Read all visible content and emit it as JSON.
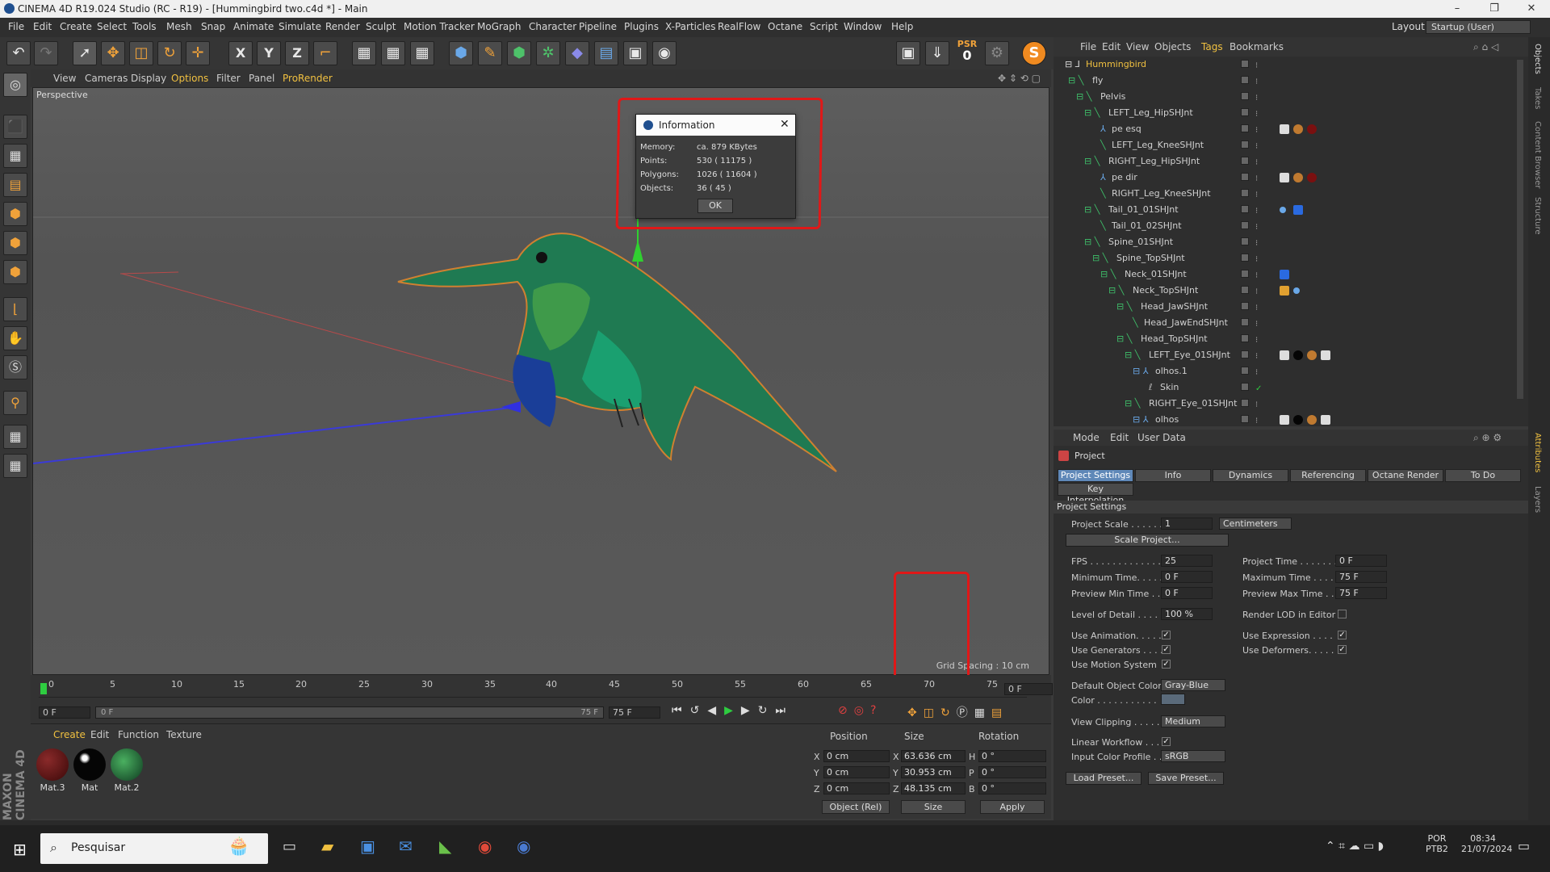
{
  "window": {
    "title": "CINEMA 4D R19.024 Studio (RC - R19) - [Hummingbird two.c4d *] - Main",
    "minimize": "–",
    "restore": "❐",
    "close": "✕"
  },
  "menubar": {
    "items": [
      "File",
      "Edit",
      "Create",
      "Select",
      "Tools",
      "Mesh",
      "Snap",
      "Animate",
      "Simulate",
      "Render",
      "Sculpt",
      "Motion Tracker",
      "MoGraph",
      "Character",
      "Pipeline",
      "Plugins",
      "X-Particles",
      "RealFlow",
      "Octane",
      "Script",
      "Window",
      "Help"
    ],
    "layout_label": "Layout:",
    "layout_value": "Startup (User)"
  },
  "toolbar": {
    "psr_label": "PSR",
    "psr_value": "0",
    "x_label": "X",
    "y_label": "Y",
    "z_label": "Z"
  },
  "viewport": {
    "menu": [
      "View",
      "Cameras",
      "Display",
      "Options",
      "Filter",
      "Panel",
      "ProRender"
    ],
    "label": "Perspective",
    "grid_spacing": "Grid Spacing : 10 cm"
  },
  "dialog": {
    "title": "Information",
    "rows": [
      {
        "label": "Memory:",
        "value": "ca. 879 KBytes"
      },
      {
        "label": "Points:",
        "value": "530 ( 11175 )"
      },
      {
        "label": "Polygons:",
        "value": "1026 ( 11604 )"
      },
      {
        "label": "Objects:",
        "value": "36 ( 45 )"
      }
    ],
    "ok_label": "OK"
  },
  "timeline": {
    "ticks": [
      "0",
      "5",
      "10",
      "15",
      "20",
      "25",
      "30",
      "35",
      "40",
      "45",
      "50",
      "55",
      "60",
      "65",
      "70",
      "75"
    ],
    "current_frame_right": "0 F",
    "start_field": "0 F",
    "slider_left": "0 F",
    "slider_right": "75 F",
    "end_field": "75 F"
  },
  "materials": {
    "tabs": [
      "Create",
      "Edit",
      "Function",
      "Texture"
    ],
    "items": [
      {
        "label": "Mat.3",
        "color": "#5a1212"
      },
      {
        "label": "Mat",
        "color": "#050505"
      },
      {
        "label": "Mat.2",
        "color": "#1f6b3a"
      }
    ],
    "brand": "MAXON CINEMA 4D"
  },
  "coords": {
    "headers": {
      "position": "Position",
      "size": "Size",
      "rotation": "Rotation"
    },
    "rows": [
      {
        "axis": "X",
        "pos": "0 cm",
        "size_axis": "X",
        "size": "63.636 cm",
        "rot_axis": "H",
        "rot": "0 °"
      },
      {
        "axis": "Y",
        "pos": "0 cm",
        "size_axis": "Y",
        "size": "30.953 cm",
        "rot_axis": "P",
        "rot": "0 °"
      },
      {
        "axis": "Z",
        "pos": "0 cm",
        "size_axis": "Z",
        "size": "48.135 cm",
        "rot_axis": "B",
        "rot": "0 °"
      }
    ],
    "mode": "Object (Rel)",
    "size_mode": "Size",
    "apply": "Apply"
  },
  "object_manager": {
    "menu": [
      "File",
      "Edit",
      "View",
      "Objects",
      "Tags",
      "Bookmarks"
    ],
    "rows": [
      {
        "name": "Hummingbird",
        "indent": 0
      },
      {
        "name": "fly",
        "indent": 1
      },
      {
        "name": "Pelvis",
        "indent": 2
      },
      {
        "name": "LEFT_Leg_HipSHJnt",
        "indent": 3
      },
      {
        "name": "pe esq",
        "indent": 4
      },
      {
        "name": "LEFT_Leg_KneeSHJnt",
        "indent": 4
      },
      {
        "name": "RIGHT_Leg_HipSHJnt",
        "indent": 3
      },
      {
        "name": "pe dir",
        "indent": 4
      },
      {
        "name": "RIGHT_Leg_KneeSHJnt",
        "indent": 4
      },
      {
        "name": "Tail_01_01SHJnt",
        "indent": 3
      },
      {
        "name": "Tail_01_02SHJnt",
        "indent": 4
      },
      {
        "name": "Spine_01SHJnt",
        "indent": 3
      },
      {
        "name": "Spine_TopSHJnt",
        "indent": 4
      },
      {
        "name": "Neck_01SHJnt",
        "indent": 5
      },
      {
        "name": "Neck_TopSHJnt",
        "indent": 6
      },
      {
        "name": "Head_JawSHJnt",
        "indent": 7
      },
      {
        "name": "Head_JawEndSHJnt",
        "indent": 8
      },
      {
        "name": "Head_TopSHJnt",
        "indent": 7
      },
      {
        "name": "LEFT_Eye_01SHJnt",
        "indent": 8
      },
      {
        "name": "olhos.1",
        "indent": 9
      },
      {
        "name": "Skin",
        "indent": 10
      },
      {
        "name": "RIGHT_Eye_01SHJnt",
        "indent": 8
      },
      {
        "name": "olhos",
        "indent": 9
      }
    ]
  },
  "attributes": {
    "menu": [
      "Mode",
      "Edit",
      "User Data"
    ],
    "object_label": "Project",
    "tabs": [
      "Project Settings",
      "Info",
      "Dynamics",
      "Referencing",
      "Octane Render",
      "To Do"
    ],
    "tab2": "Key Interpolation",
    "section": "Project Settings",
    "project_scale_label": "Project Scale . . . . . .",
    "project_scale_value": "1",
    "project_scale_unit": "Centimeters",
    "scale_project_btn": "Scale Project...",
    "fps_label": "FPS . . . . . . . . . . . . . .",
    "fps_value": "25",
    "project_time_label": "Project Time . . . . . . .",
    "project_time_value": "0 F",
    "min_time_label": "Minimum Time. . . . . .",
    "min_time_value": "0 F",
    "max_time_label": "Maximum Time . . . . .",
    "max_time_value": "75 F",
    "prev_min_label": "Preview Min Time . . .",
    "prev_min_value": "0 F",
    "prev_max_label": "Preview Max Time . .",
    "prev_max_value": "75 F",
    "lod_label": "Level of Detail . . . . .",
    "lod_value": "100 %",
    "render_lod_label": "Render LOD in Editor",
    "use_anim_label": "Use Animation. . . . .",
    "use_expr_label": "Use Expression . . . .",
    "use_gen_label": "Use Generators . . . .",
    "use_def_label": "Use Deformers. . . . .",
    "use_motion_label": "Use Motion System",
    "default_color_label": "Default Object Color",
    "default_color_value": "Gray-Blue",
    "color_label": "Color . . . . . . . . . . .",
    "view_clip_label": "View Clipping . . . . .",
    "view_clip_value": "Medium",
    "linear_label": "Linear Workflow . . .",
    "input_profile_label": "Input Color Profile . .",
    "input_profile_value": "sRGB",
    "load_preset": "Load Preset...",
    "save_preset": "Save Preset..."
  },
  "right_strip": [
    "Objects",
    "Takes",
    "Content Browser",
    "Structure",
    "Attributes",
    "Layers"
  ],
  "taskbar": {
    "search_placeholder": "Pesquisar",
    "lang1": "POR",
    "lang2": "PTB2",
    "time": "08:34",
    "date": "21/07/2024"
  },
  "check": "✓"
}
